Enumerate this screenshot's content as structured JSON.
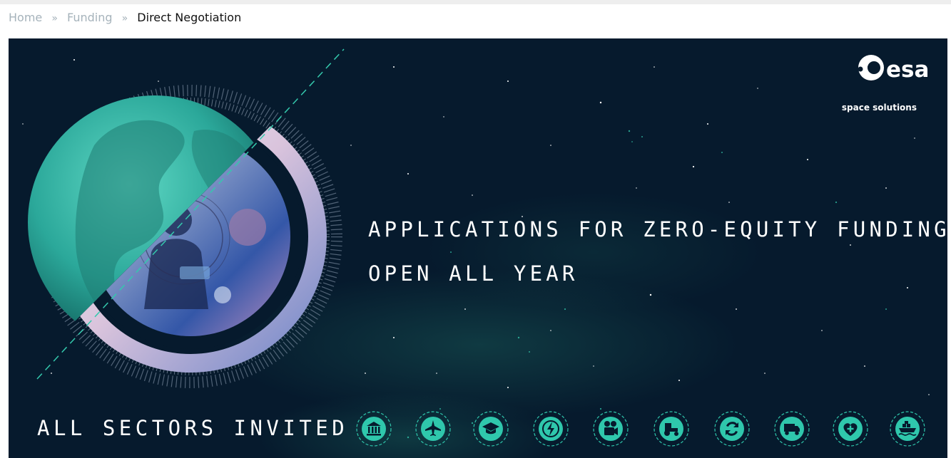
{
  "breadcrumb": {
    "items": [
      {
        "label": "Home"
      },
      {
        "label": "Funding"
      }
    ],
    "separator": "»",
    "current": "Direct Negotiation"
  },
  "banner": {
    "logo": {
      "wordmark": "esa",
      "tagline": "space solutions"
    },
    "headline": {
      "line1": "APPLICATIONS FOR ZERO-EQUITY FUNDING",
      "line2": "OPEN ALL YEAR"
    },
    "sectors_title": "ALL SECTORS INVITED",
    "sector_icons": [
      "institution-icon",
      "airplane-icon",
      "graduation-cap-icon",
      "energy-icon",
      "media-camera-icon",
      "tractor-icon",
      "recycle-icon",
      "truck-icon",
      "health-heart-icon",
      "ship-icon"
    ],
    "colors": {
      "background": "#061a2d",
      "accent": "#2fc7ac",
      "text": "#ffffff",
      "breadcrumb_link": "#a6b3bb"
    }
  }
}
